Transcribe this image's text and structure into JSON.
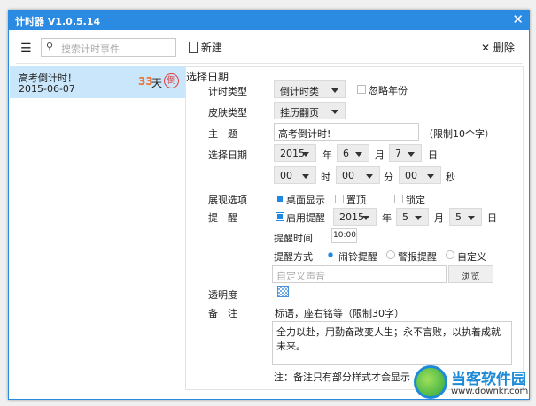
{
  "window": {
    "title": "计时器 V1.0.5.14"
  },
  "toolbar": {
    "search_placeholder": "搜索计时事件",
    "new_label": "新建",
    "delete_label": "删除"
  },
  "events": [
    {
      "title": "高考倒计时！",
      "date": "2015-06-07",
      "days": "33",
      "unit": "天",
      "badge": "倒"
    }
  ],
  "form": {
    "section_title": "选择日期",
    "timer_type_label": "计时类型",
    "timer_type": "倒计时类",
    "ignore_year": "忽略年份",
    "skin_label": "皮肤类型",
    "skin": "挂历翻页",
    "subject_label": "主　题",
    "subject": "高考倒计时!",
    "subject_limit": "（限制10个字）",
    "date_label": "选择日期",
    "year": "2015",
    "year_unit": "年",
    "month": "6",
    "month_unit": "月",
    "day": "7",
    "day_unit": "日",
    "hour": "00",
    "hour_unit": "时",
    "minute": "00",
    "minute_unit": "分",
    "second": "00",
    "second_unit": "秒",
    "display_label": "展现选项",
    "desktop_show": "桌面显示",
    "pin_top": "置顶",
    "lock": "锁定",
    "remind_label": "提　醒",
    "enable_remind": "启用提醒",
    "remind_year": "2015",
    "remind_month": "5",
    "remind_day": "5",
    "remind_time_label": "提醒时间",
    "remind_time": "10:00",
    "remind_mode_label": "提醒方式",
    "mode_alarm": "闹铃提醒",
    "mode_siren": "警报提醒",
    "mode_custom": "自定义",
    "custom_sound_placeholder": "自定义声音",
    "browse": "浏览",
    "opacity_label": "透明度",
    "note_label": "备　注",
    "note_hint": "标语，座右铭等（限制30字）",
    "note_value": "全力以赴，用勤奋改变人生；永不言败，以执着成就未来。",
    "note_footer": "注：备注只有部分样式才会显示"
  },
  "watermark": {
    "name": "当客软件园",
    "url": "www.downkr.com"
  },
  "colors": {
    "titlebar": "#2b8be2",
    "accent": "#1e88e5",
    "days": "#f07030",
    "selected": "#c9e6fb"
  }
}
